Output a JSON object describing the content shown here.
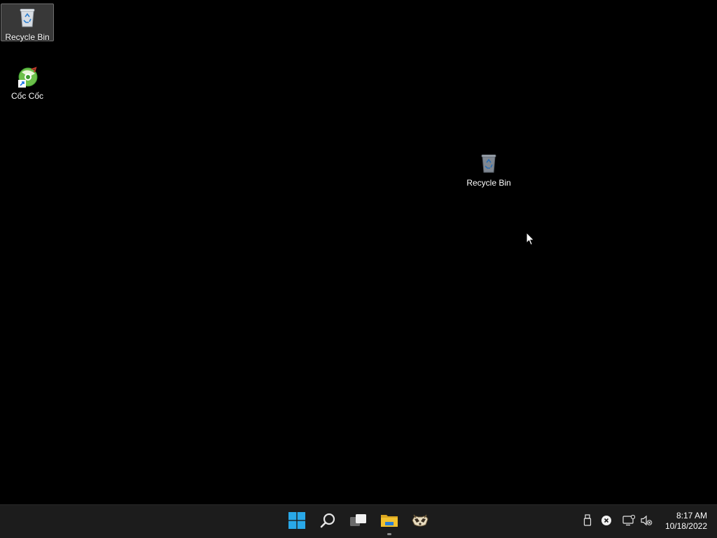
{
  "desktop": {
    "icons": [
      {
        "label": "Recycle Bin",
        "icon": "recycle-bin-icon",
        "selected": true
      },
      {
        "label": "Cốc Cốc",
        "icon": "coccoc-browser-icon",
        "selected": false
      },
      {
        "label": "Recycle Bin",
        "icon": "recycle-bin-icon",
        "selected": false
      }
    ]
  },
  "taskbar": {
    "buttons": [
      {
        "name": "start",
        "icon": "windows-logo-icon"
      },
      {
        "name": "search",
        "icon": "search-icon"
      },
      {
        "name": "task-view",
        "icon": "task-view-icon"
      },
      {
        "name": "file-explorer",
        "icon": "folder-icon",
        "running": true
      },
      {
        "name": "app",
        "icon": "raccoon-app-icon"
      }
    ],
    "tray": {
      "icons": [
        "usb-icon",
        "close-circle-icon",
        "network-icon",
        "volume-muted-icon"
      ]
    },
    "clock": {
      "time": "8:17 AM",
      "date": "10/18/2022"
    }
  },
  "colors": {
    "desktop_bg": "#000000",
    "taskbar_bg": "#1c1c1c",
    "windows_blue": "#29a8e8",
    "folder_yellow": "#f2c12e"
  }
}
